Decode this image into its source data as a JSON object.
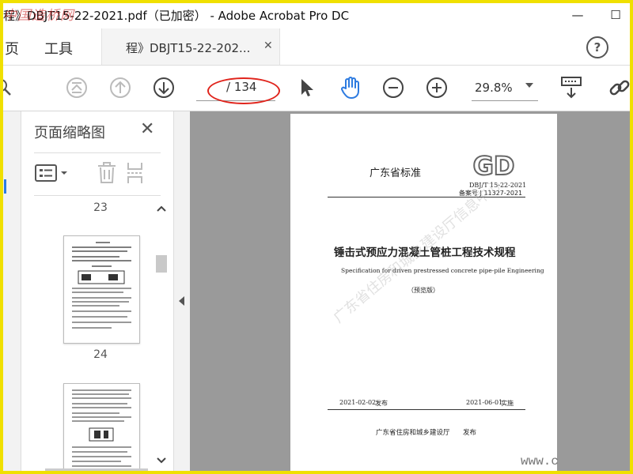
{
  "window": {
    "title": "程》DBJT15-22-2021.pdf（已加密） - Adobe Acrobat Pro DC",
    "watermark_text": "中国造桥网",
    "controls": {
      "minimize": "—",
      "maximize": "☐",
      "close": "✕"
    }
  },
  "tabs": {
    "home": "页",
    "tools": "工具",
    "document_tab": "程》DBJT15-22-202...",
    "document_tab_close": "✕",
    "help": "?"
  },
  "toolbar": {
    "page_current": "",
    "page_total": "/ 134",
    "zoom": "29.8%",
    "icons": [
      "search-icon",
      "first-page-icon",
      "prev-page-icon",
      "next-page-icon",
      "select-cursor-icon",
      "hand-tool-icon",
      "zoom-out-icon",
      "zoom-in-icon",
      "keyboard-fit-icon",
      "link-icon"
    ]
  },
  "sidebar": {
    "title": "页面缩略图",
    "close": "✕",
    "page_labels": [
      "23",
      "24"
    ]
  },
  "document": {
    "standard_title": "广东省标准",
    "logo_text": "GD",
    "code": "DBJ/T 15-22-2021",
    "record": "备案号  J 11327-2021",
    "main_title": "锤击式预应力混凝土管桩工程技术规程",
    "english_title": "Specification for driven prestressed concrete pipe-pile Engineering",
    "edition": "（预览版）",
    "issue_date": "2021-02-02",
    "issue_label": "发布",
    "effective_date": "2021-06-01",
    "effective_label": "实施",
    "issuer": "广东省住房和城乡建设厅",
    "issuer_action": "发布",
    "diagonal_watermark": "广东省住房和城乡建设厅信息中心"
  },
  "corner_watermark": "www.c",
  "colors": {
    "annotation_red": "#e0241c",
    "highlight_yellow": "#f0e000",
    "accent_blue": "#2d7be0"
  }
}
